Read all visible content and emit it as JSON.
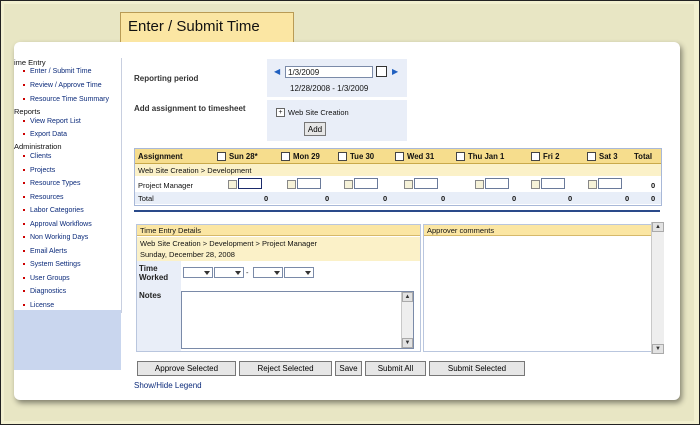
{
  "title": "Enter / Submit Time",
  "sidebar": {
    "groups": [
      {
        "label": "ime Entry",
        "items": [
          "Enter / Submit Time",
          "Review / Approve Time",
          "Resource Time Summary"
        ]
      },
      {
        "label": "Reports",
        "items": [
          "View Report List",
          "Export Data"
        ]
      },
      {
        "label": "Administration",
        "items": [
          "Clients",
          "Projects",
          "Resource Types",
          "Resources",
          "Labor Categories",
          "Approval Workflows",
          "Non Working Days",
          "Email Alerts",
          "System Settings",
          "User Groups",
          "Diagnostics",
          "License"
        ]
      }
    ]
  },
  "period": {
    "label": "Reporting period",
    "date_value": "1/3/2009",
    "range": "12/28/2008 - 1/3/2009"
  },
  "assignment": {
    "label": "Add assignment to timesheet",
    "tree_item": "Web Site Creation",
    "add_button": "Add"
  },
  "grid": {
    "assignment_header": "Assignment",
    "days": [
      "Sun 28*",
      "Mon 29",
      "Tue 30",
      "Wed 31",
      "Thu Jan 1",
      "Fri 2",
      "Sat 3"
    ],
    "total_header": "Total",
    "project_path": "Web Site Creation > Development",
    "role": "Project Manager",
    "row_total": "0",
    "total_label": "Total",
    "day_totals": [
      "0",
      "0",
      "0",
      "0",
      "0",
      "0",
      "0"
    ],
    "grand_total": "0"
  },
  "details": {
    "header": "Time Entry Details",
    "path": "Web Site Creation > Development > Project Manager",
    "date": "Sunday, December 28, 2008",
    "time_worked_label": "Time Worked",
    "separator": "-",
    "notes_label": "Notes"
  },
  "approver": {
    "header": "Approver comments"
  },
  "buttons": {
    "approve": "Approve Selected",
    "reject": "Reject Selected",
    "save": "Save",
    "submit_all": "Submit All",
    "submit_selected": "Submit Selected"
  },
  "legend_link": "Show/Hide Legend"
}
